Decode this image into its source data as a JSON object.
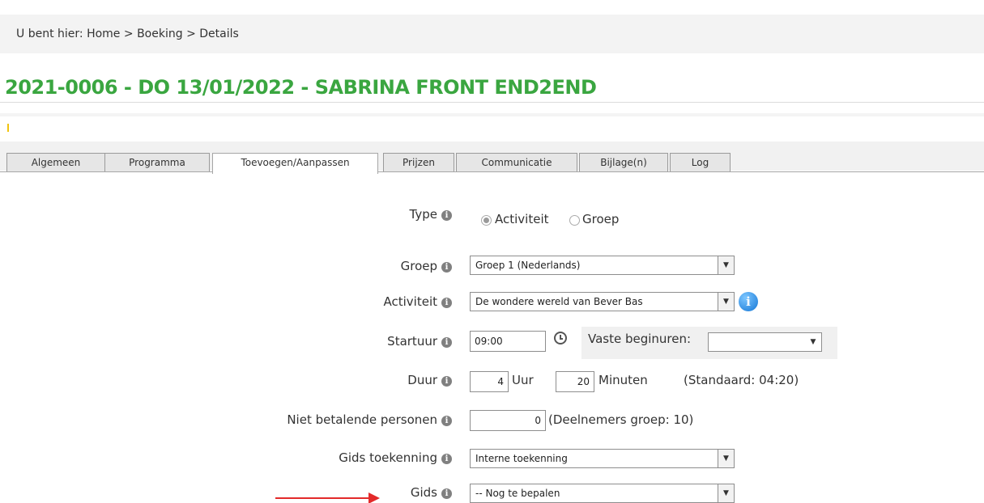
{
  "breadcrumb": {
    "prefix": "U bent hier:",
    "home": "Home",
    "sep1": ">",
    "booking": "Boeking",
    "sep2": ">",
    "details": "Details"
  },
  "page_title": "2021-0006 - DO 13/01/2022 - SABRINA FRONT END2END",
  "tabs": [
    {
      "label": "Algemeen",
      "active": false
    },
    {
      "label": "Programma",
      "active": false
    },
    {
      "label": "Toevoegen/Aanpassen",
      "active": true
    },
    {
      "label": "Prijzen",
      "active": false
    },
    {
      "label": "Communicatie",
      "active": false
    },
    {
      "label": "Bijlage(n)",
      "active": false
    },
    {
      "label": "Log",
      "active": false
    }
  ],
  "form": {
    "type": {
      "label": "Type",
      "options": [
        {
          "label": "Activiteit",
          "selected": true
        },
        {
          "label": "Groep",
          "selected": false
        }
      ]
    },
    "groep": {
      "label": "Groep",
      "value": "Groep 1 (Nederlands)"
    },
    "activiteit": {
      "label": "Activiteit",
      "value": "De wondere wereld van Bever Bas"
    },
    "startuur": {
      "label": "Startuur",
      "value": "09:00",
      "fixed_label": "Vaste beginuren:",
      "fixed_value": ""
    },
    "duur": {
      "label": "Duur",
      "hours": "4",
      "hours_unit": "Uur",
      "minutes": "20",
      "minutes_unit": "Minuten",
      "default_text": "(Standaard: 04:20)"
    },
    "niet_betalend": {
      "label": "Niet betalende personen",
      "value": "0",
      "note": "(Deelnemers groep: 10)"
    },
    "gids_toekenning": {
      "label": "Gids toekenning",
      "value": "Interne toekenning"
    },
    "gids": {
      "label": "Gids",
      "value": "-- Nog te bepalen"
    }
  },
  "icons": {
    "info": "info-icon",
    "dropdown": "chevron-down-icon",
    "clock": "clock-icon",
    "blue_info": "info-circle-icon",
    "arrow": "red-arrow-annotation"
  },
  "colors": {
    "title": "#3aa640",
    "annotation_arrow": "#e32a2a"
  },
  "glyphs": {
    "info": "i",
    "arrow_down": "▼"
  }
}
